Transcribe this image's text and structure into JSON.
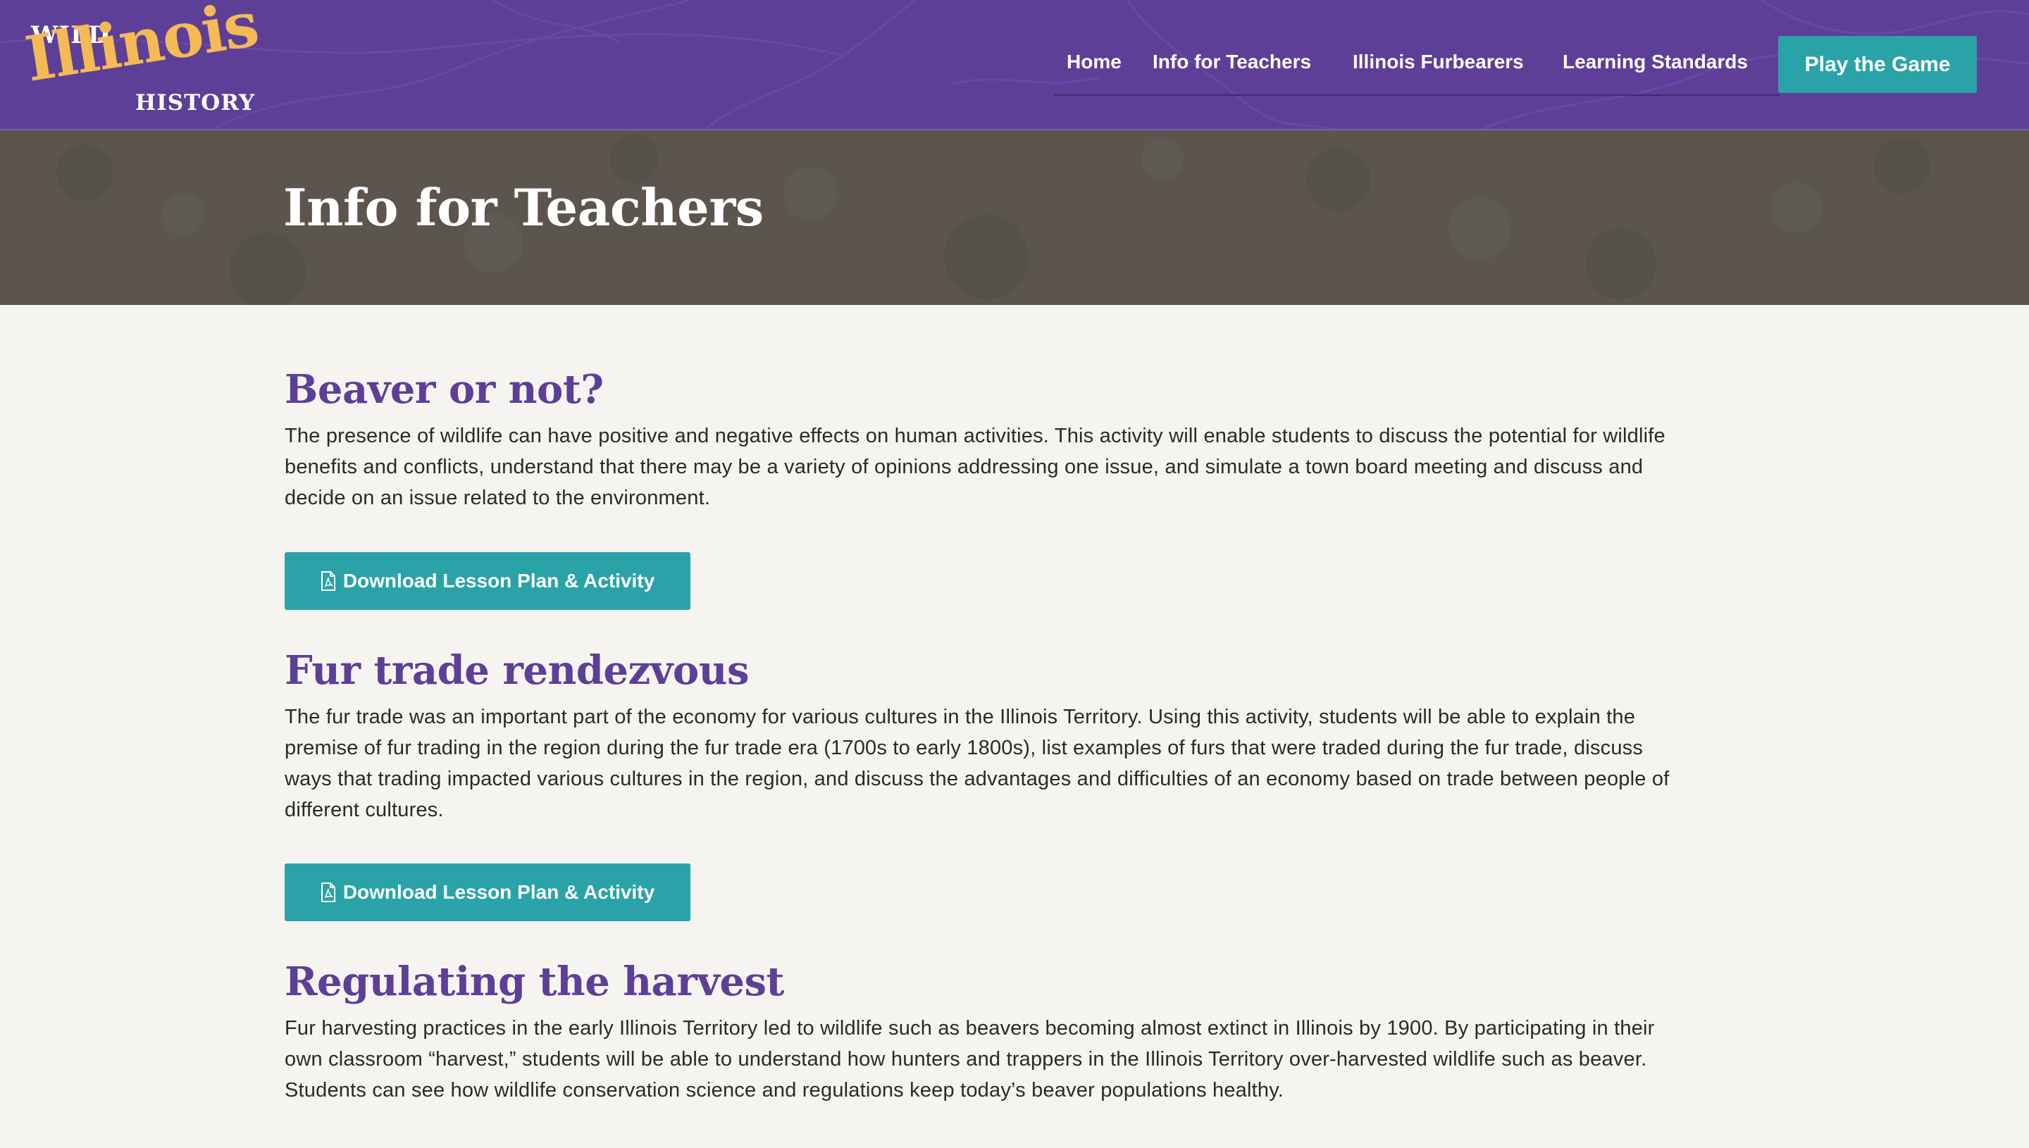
{
  "header": {
    "logo": {
      "wild": "WILD",
      "illinois": "Illinois",
      "history": "HISTORY"
    },
    "nav": [
      {
        "label": "Home"
      },
      {
        "label": "Info for Teachers"
      },
      {
        "label": "Illinois Furbearers"
      },
      {
        "label": "Learning Standards"
      }
    ],
    "cta_label": "Play the Game"
  },
  "hero": {
    "title": "Info for Teachers"
  },
  "lessons": [
    {
      "title": "Beaver or not?",
      "description": "The presence of wildlife can have positive and negative effects on human activities. This activity will enable students to discuss the potential for wildlife benefits and conflicts, understand that there may be a variety of opinions addressing one issue, and simulate a town board meeting and discuss and decide on an issue related to the environment.",
      "button_label": "Download Lesson Plan & Activity",
      "button_icon": "pdf-file-icon"
    },
    {
      "title": "Fur trade rendezvous",
      "description": "The fur trade was an important part of the economy for various cultures in the Illinois Territory. Using this activity, students will be able to explain the premise of fur trading in the region during the fur trade era (1700s to early 1800s), list examples of furs that were traded during the fur trade, discuss ways that trading impacted various cultures in the region, and discuss the advantages and difficulties of an economy based on trade between people of different cultures.",
      "button_label": "Download Lesson Plan & Activity",
      "button_icon": "pdf-file-icon"
    },
    {
      "title": "Regulating the harvest",
      "description": "Fur harvesting practices in the early Illinois Territory led to wildlife such as beavers becoming almost extinct in Illinois by 1900. By participating in their own classroom “harvest,” students will be able to understand how hunters and trappers in the Illinois Territory over-harvested wildlife such as beaver. Students can see how wildlife conservation science and regulations keep today’s beaver populations healthy."
    }
  ],
  "colors": {
    "header_purple": "#5d3f98",
    "logo_gold": "#f5b955",
    "teal_button": "#2aa3a8",
    "hero_brown": "#5b554e",
    "page_background": "#f6f4f0",
    "heading_purple": "#5d3f98",
    "body_text": "#2a2a2a"
  }
}
